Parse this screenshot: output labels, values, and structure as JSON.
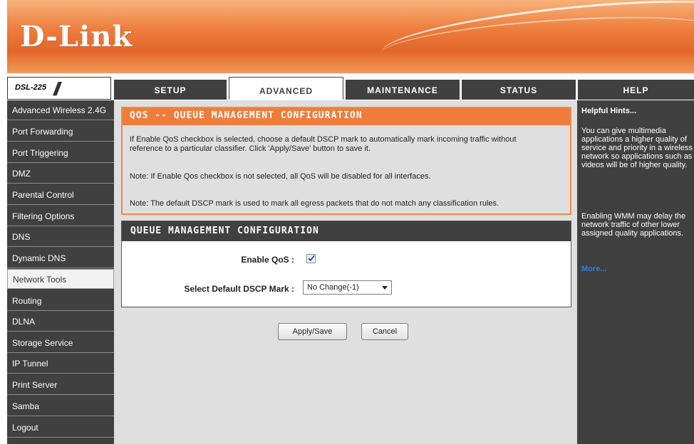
{
  "brand": {
    "logo": "D-Link",
    "model": "DSL-225"
  },
  "tabs": [
    {
      "label": "SETUP"
    },
    {
      "label": "ADVANCED"
    },
    {
      "label": "MAINTENANCE"
    },
    {
      "label": "STATUS"
    },
    {
      "label": "HELP"
    }
  ],
  "sidebar": {
    "items": [
      {
        "label": "Advanced Wireless 2.4G"
      },
      {
        "label": "Port Forwarding"
      },
      {
        "label": "Port Triggering"
      },
      {
        "label": "DMZ"
      },
      {
        "label": "Parental Control"
      },
      {
        "label": "Filtering Options"
      },
      {
        "label": "DNS"
      },
      {
        "label": "Dynamic DNS"
      },
      {
        "label": "Network Tools"
      },
      {
        "label": "Routing"
      },
      {
        "label": "DLNA"
      },
      {
        "label": "Storage Service"
      },
      {
        "label": "IP Tunnel"
      },
      {
        "label": "Print Server"
      },
      {
        "label": "Samba"
      },
      {
        "label": "Logout"
      }
    ],
    "selected": "Network Tools"
  },
  "intro": {
    "title": "QOS -- QUEUE MANAGEMENT CONFIGURATION",
    "text1_line1": "If Enable QoS checkbox is selected, choose a default DSCP mark to automatically mark incoming traffic without",
    "text1_line2": "reference to a particular classifier. Click 'Apply/Save' button to save it.",
    "text2": "Note: If Enable Qos checkbox is not selected, all QoS will be disabled for all interfaces.",
    "text3": "Note: The default DSCP mark is used to mark all egress packets that do not match any classification rules."
  },
  "config": {
    "title": "QUEUE MANAGEMENT CONFIGURATION",
    "enable_label": "Enable QoS :",
    "enable_checked": true,
    "dscp_label": "Select Default DSCP Mark :",
    "dscp_value": "No Change(-1)"
  },
  "buttons": {
    "apply": "Apply/Save",
    "cancel": "Cancel"
  },
  "help": {
    "title": "Helpful Hints...",
    "p1": "You can give multimedia applications a higher quality of service and priority in a wireless network so applications such as videos will be of higher quality.",
    "p2": "Enabling WMM may delay the network traffic of other lower assigned quality applications.",
    "more": "More..."
  },
  "colors": {
    "accent": "#ee7d3c",
    "dark": "#404040",
    "link": "#2d7fd2"
  }
}
